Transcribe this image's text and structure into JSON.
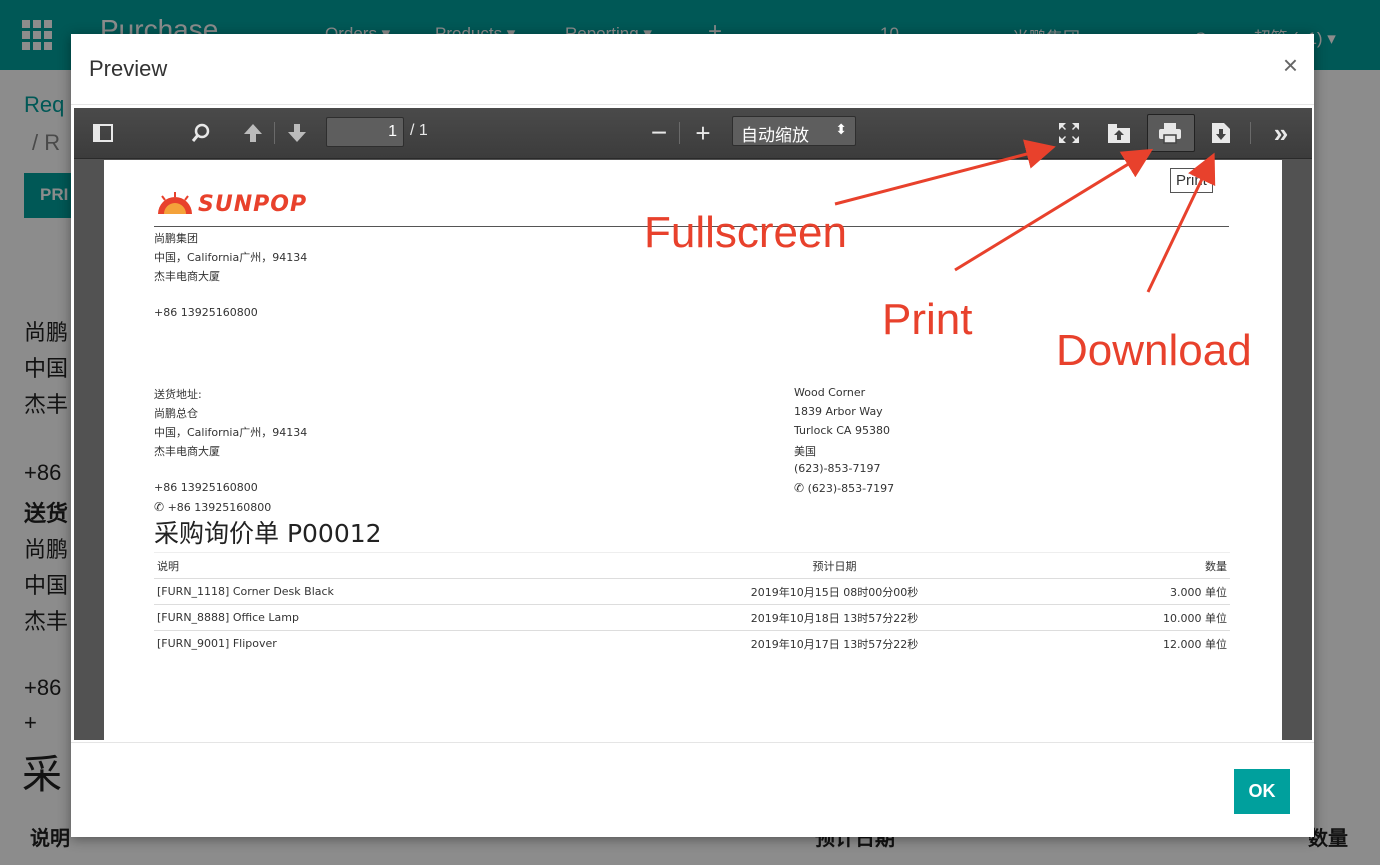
{
  "background": {
    "brand": "Purchase",
    "menu": [
      "Orders ▾",
      "Products ▾",
      "Reporting ▾",
      "+"
    ],
    "activity_count": "10",
    "company": "尚鹏集团 ▾",
    "user": "Sunpop超管 (p1) ▾",
    "breadcrumb": "Req",
    "breadcrumb2": "/ R",
    "print_button": "PRI",
    "left_lines": [
      "尚鹏",
      "中国",
      "杰丰",
      "+86",
      "送货",
      "尚鹏",
      "中国",
      "杰丰",
      "+86",
      "+",
      "采"
    ],
    "table_headers": [
      "说明",
      "预计日期",
      "数量"
    ]
  },
  "modal": {
    "title": "Preview",
    "close_label": "×",
    "ok_label": "OK"
  },
  "toolbar": {
    "page_value": "1",
    "page_total": "/ 1",
    "zoom": "自动缩放",
    "tooltip": "Print"
  },
  "pdf": {
    "logo": "SUNPOP",
    "company_lines": [
      "尚鹏集团",
      "中国，California广州，94134",
      "杰丰电商大厦"
    ],
    "company_phone": "+86 13925160800",
    "ship_label": "送货地址:",
    "ship_lines": [
      "尚鹏总仓",
      "中国，California广州，94134",
      "杰丰电商大厦"
    ],
    "ship_phone": "+86 13925160800",
    "ship_phone2": "+86 13925160800",
    "vendor_lines": [
      "Wood Corner",
      "1839 Arbor Way",
      "Turlock CA 95380",
      "美国",
      "(623)-853-7197"
    ],
    "vendor_phone": "(623)-853-7197",
    "doc_title": "采购询价单 P00012",
    "columns": [
      "说明",
      "预计日期",
      "数量"
    ],
    "rows": [
      {
        "desc": "[FURN_1118] Corner Desk Black",
        "date": "2019年10月15日 08时00分00秒",
        "qty": "3.000 单位"
      },
      {
        "desc": "[FURN_8888] Office Lamp",
        "date": "2019年10月18日 13时57分22秒",
        "qty": "10.000 单位"
      },
      {
        "desc": "[FURN_9001] Flipover",
        "date": "2019年10月17日 13时57分22秒",
        "qty": "12.000 单位"
      }
    ]
  },
  "annotations": {
    "fullscreen": "Fullscreen",
    "print": "Print",
    "download": "Download",
    "color": "#e8412c"
  },
  "colors": {
    "primary": "#00a09d",
    "toolbar": "#474747",
    "viewer_bg": "#525252"
  }
}
